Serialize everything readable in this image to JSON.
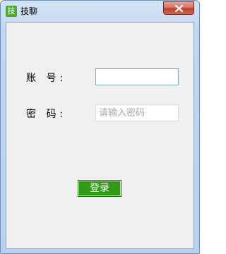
{
  "window": {
    "title": "技聊",
    "icon_char": "技",
    "icon_color": "#4cab2e"
  },
  "form": {
    "account_label": "账 号:",
    "account_value": "",
    "password_label": "密 码:",
    "password_placeholder": "请输入密码"
  },
  "login_button": {
    "label": "登录",
    "color": "#2f9a14"
  }
}
